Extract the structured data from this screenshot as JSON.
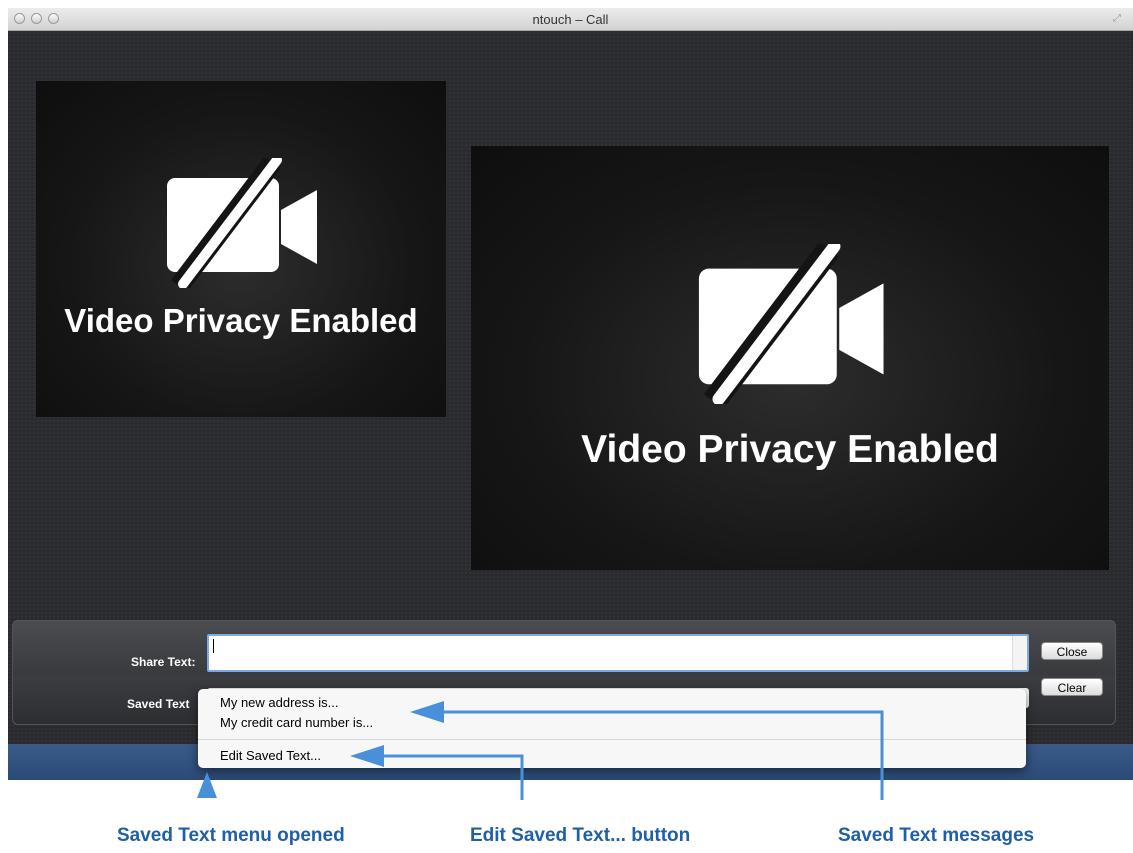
{
  "window": {
    "title": "ntouch – Call"
  },
  "video": {
    "local_caption": "Video Privacy Enabled",
    "remote_caption": "Video Privacy Enabled"
  },
  "panel": {
    "share_text_label": "Share Text:",
    "share_text_value": "",
    "saved_text_label": "Saved Text",
    "close_button": "Close",
    "clear_button": "Clear"
  },
  "menu": {
    "items": [
      "My new address is...",
      "My credit card number is..."
    ],
    "edit_item": "Edit Saved Text..."
  },
  "annotations": {
    "menu_opened": "Saved Text menu opened",
    "edit_button": "Edit Saved Text... button",
    "messages": "Saved Text messages"
  },
  "colors": {
    "annotation": "#1f5ea8",
    "arrow": "#4a90d9"
  }
}
